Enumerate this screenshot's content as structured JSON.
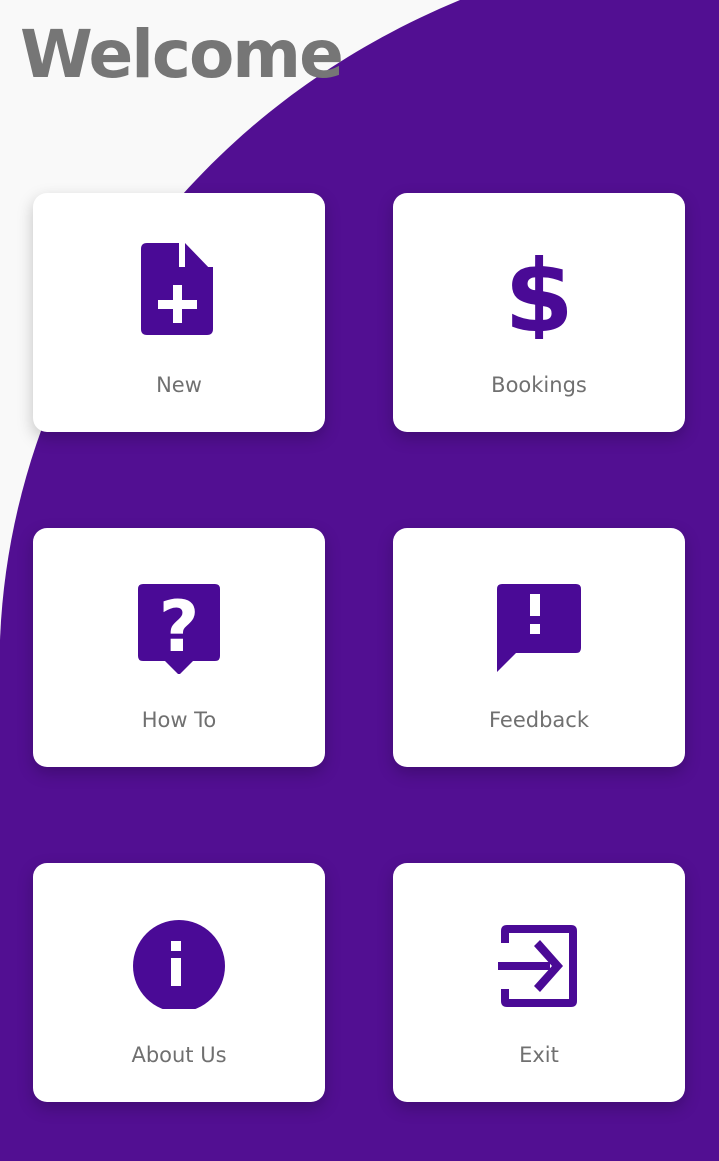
{
  "header": {
    "title": "Welcome"
  },
  "colors": {
    "accent": "#4a0a96",
    "background_shape": "#520f92",
    "page_background": "#f9f9f9",
    "card_background": "#ffffff",
    "label_text": "#707070",
    "title_text": "#767676"
  },
  "menu": {
    "items": [
      {
        "label": "New",
        "icon": "note-add-icon"
      },
      {
        "label": "Bookings",
        "icon": "dollar-icon"
      },
      {
        "label": "How To",
        "icon": "help-bubble-icon"
      },
      {
        "label": "Feedback",
        "icon": "feedback-icon"
      },
      {
        "label": "About Us",
        "icon": "info-icon"
      },
      {
        "label": "Exit",
        "icon": "exit-icon"
      }
    ]
  }
}
